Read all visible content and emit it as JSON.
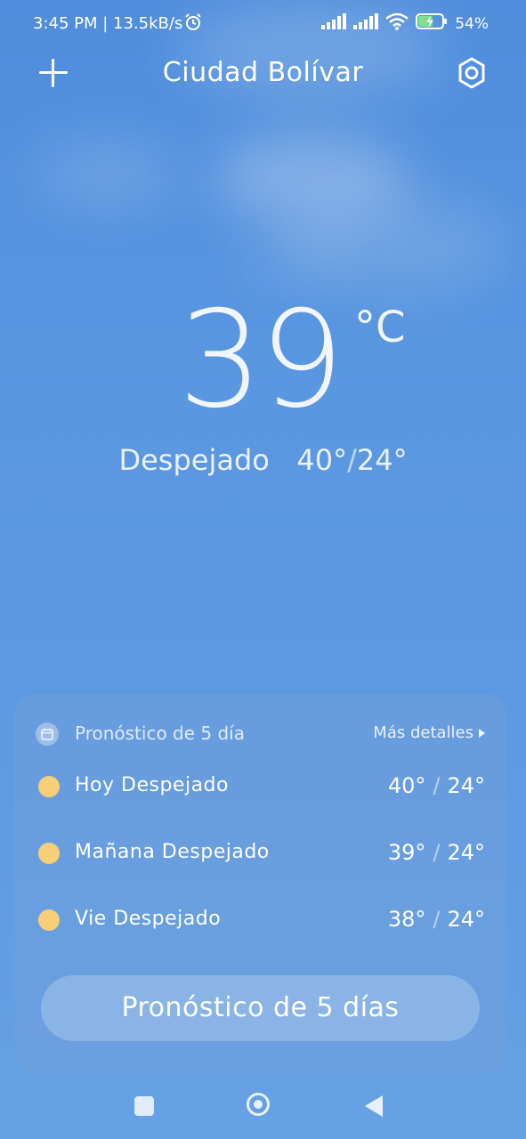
{
  "status_bar": {
    "time_speed": "3:45 PM | 13.5kB/s",
    "battery_percent": "54%",
    "icons": [
      "alarm-icon",
      "signal-icon",
      "signal-icon",
      "wifi-icon",
      "battery-charging-icon"
    ]
  },
  "header": {
    "city": "Ciudad Bolívar",
    "add_icon": "plus-icon",
    "settings_icon": "settings-icon"
  },
  "current": {
    "temperature": "39",
    "unit": "°C",
    "condition": "Despejado",
    "high": "40°",
    "low": "24°"
  },
  "forecast": {
    "title": "Pronóstico de 5 día",
    "more_link": "Más detalles",
    "days": [
      {
        "label": "Hoy  Despejado",
        "high": "40°",
        "low": "24°"
      },
      {
        "label": "Mañana  Despejado",
        "high": "39°",
        "low": "24°"
      },
      {
        "label": "Vie  Despejado",
        "high": "38°",
        "low": "24°"
      }
    ],
    "button_label": "Pronóstico de 5 días"
  },
  "colors": {
    "sky_top": "#4f8ddc",
    "sky_bottom": "#66a1e5",
    "sun_dot": "#f6cf78"
  }
}
